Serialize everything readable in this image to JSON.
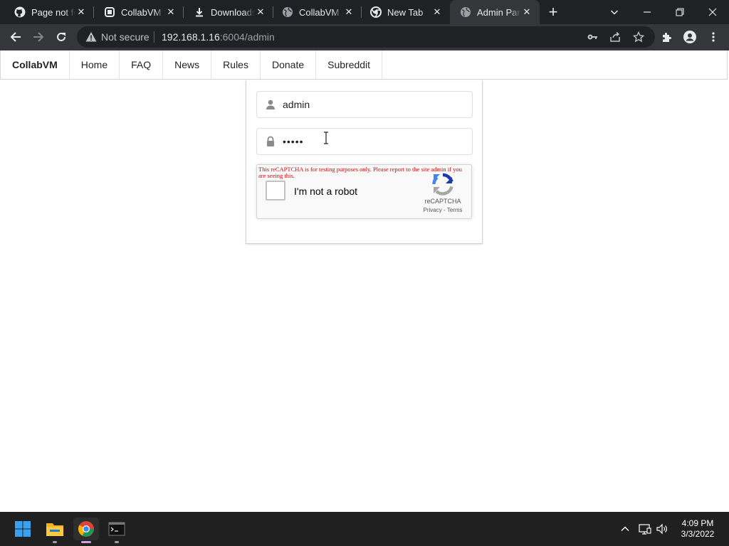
{
  "browser": {
    "tabs": [
      {
        "title": "Page not found",
        "icon": "github-icon",
        "active": false
      },
      {
        "title": "CollabVM Server",
        "icon": "collabvm-icon",
        "active": false
      },
      {
        "title": "Downloads",
        "icon": "download-icon",
        "active": false
      },
      {
        "title": "CollabVM",
        "icon": "globe-icon",
        "active": false
      },
      {
        "title": "New Tab",
        "icon": "chrome-icon",
        "active": false
      },
      {
        "title": "Admin Panel",
        "icon": "globe-icon",
        "active": true
      }
    ],
    "close_glyph": "✕",
    "new_tab_glyph": "+",
    "security_label": "Not secure",
    "url_host": "192.168.1.16",
    "url_rest": ":6004/admin"
  },
  "site_nav": {
    "brand": "CollabVM",
    "items": [
      "Home",
      "FAQ",
      "News",
      "Rules",
      "Donate",
      "Subreddit"
    ]
  },
  "login": {
    "username_value": "admin",
    "password_value": "•••••"
  },
  "recaptcha": {
    "test_message": "This reCAPTCHA is for testing purposes only. Please report to the site admin if you are seeing this.",
    "checkbox_label": "I'm not a robot",
    "brand": "reCAPTCHA",
    "privacy": "Privacy",
    "terms_sep": " - ",
    "terms": "Terms"
  },
  "taskbar": {
    "time": "4:09 PM",
    "date": "3/3/2022"
  },
  "colors": {
    "tab_strip": "#202124",
    "toolbar": "#35363a",
    "omnibox": "#202124",
    "taskbar": "#202020",
    "recaptcha_warning": "#dd0000"
  }
}
